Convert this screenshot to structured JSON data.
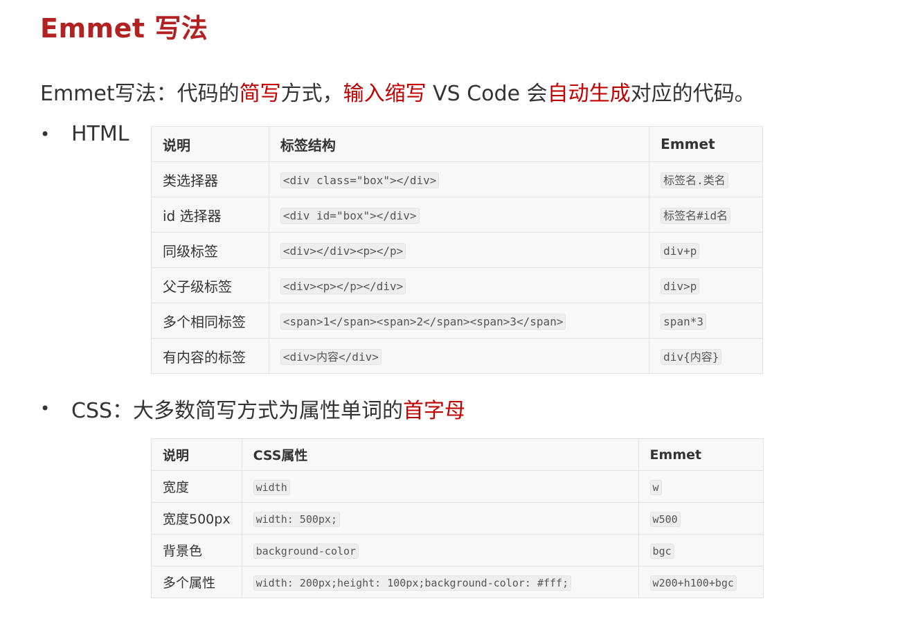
{
  "title": "Emmet 写法",
  "intro": {
    "p1": "Emmet写法：代码的",
    "r1": "简写",
    "p2": "方式，",
    "r2": "输入缩写",
    "p3": " VS Code 会",
    "r3": "自动生成",
    "p4": "对应的代码。"
  },
  "html_section": {
    "bullet": "•",
    "label": "HTML",
    "headers": [
      "说明",
      "标签结构",
      "Emmet"
    ],
    "rows": [
      [
        "类选择器",
        "<div class=\"box\"></div>",
        "标签名.类名"
      ],
      [
        "id 选择器",
        "<div id=\"box\"></div>",
        "标签名#id名"
      ],
      [
        "同级标签",
        "<div></div><p></p>",
        "div+p"
      ],
      [
        "父子级标签",
        "<div><p></p></div>",
        "div>p"
      ],
      [
        "多个相同标签",
        "<span>1</span><span>2</span><span>3</span>",
        "span*3"
      ],
      [
        "有内容的标签",
        "<div>内容</div>",
        "div{内容}"
      ]
    ]
  },
  "css_section": {
    "bullet": "•",
    "label": "CSS：大多数简写方式为属性单词的",
    "label_red": "首字母",
    "headers": [
      "说明",
      "CSS属性",
      "Emmet"
    ],
    "rows": [
      [
        "宽度",
        "width",
        "w"
      ],
      [
        "宽度500px",
        "width: 500px;",
        "w500"
      ],
      [
        "背景色",
        "background-color",
        "bgc"
      ],
      [
        "多个属性",
        "width: 200px;height: 100px;background-color: #fff;",
        "w200+h100+bgc"
      ]
    ]
  },
  "colors": {
    "title": "#b22222",
    "highlight": "#c00000",
    "table_bg": "#f8f8f8"
  }
}
